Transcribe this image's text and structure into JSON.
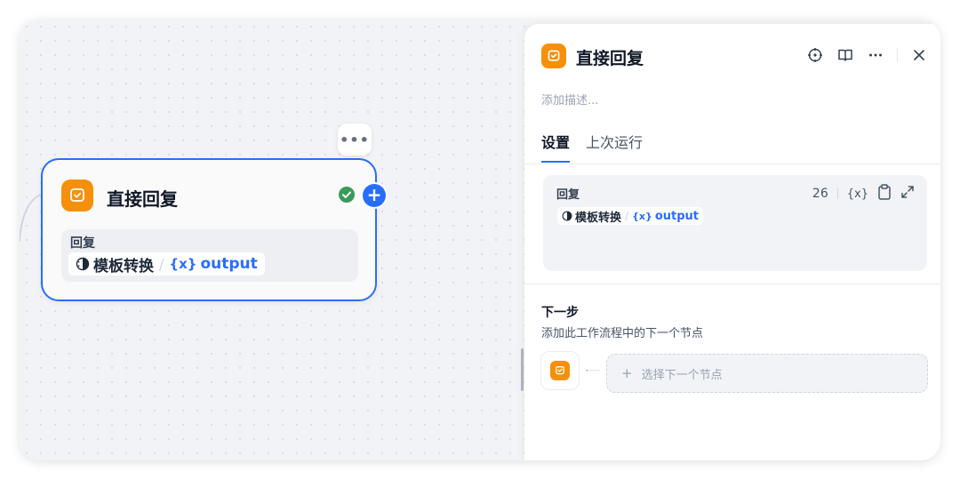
{
  "node": {
    "title": "直接回复",
    "more_label": "•••",
    "plus_label": "+",
    "body_label": "回复",
    "var_source": "模板转换",
    "var_sep": "/",
    "var_symbol": "{x}",
    "var_name": "output"
  },
  "panel": {
    "title": "直接回复",
    "description_placeholder": "添加描述...",
    "tabs": [
      {
        "label": "设置",
        "active": true
      },
      {
        "label": "上次运行",
        "active": false
      }
    ],
    "reply": {
      "label": "回复",
      "char_count": "26",
      "var_insert_label": "{x}",
      "var_source": "模板转换",
      "var_sep": "/",
      "var_symbol": "{x}",
      "var_name": "output"
    },
    "next_step": {
      "title": "下一步",
      "description": "添加此工作流程中的下一个节点",
      "select_plus": "+",
      "select_label": "选择下一个节点"
    },
    "close_label": "×"
  },
  "colors": {
    "accent": "#296dff",
    "node_icon": "#f79009",
    "success": "#3a9b5b"
  },
  "icons": [
    "answer-node-icon",
    "check-circle-icon",
    "add-node-icon",
    "locate-icon",
    "book-icon",
    "more-icon",
    "close-icon",
    "variable-icon",
    "clipboard-icon",
    "expand-icon",
    "template-transform-icon"
  ]
}
